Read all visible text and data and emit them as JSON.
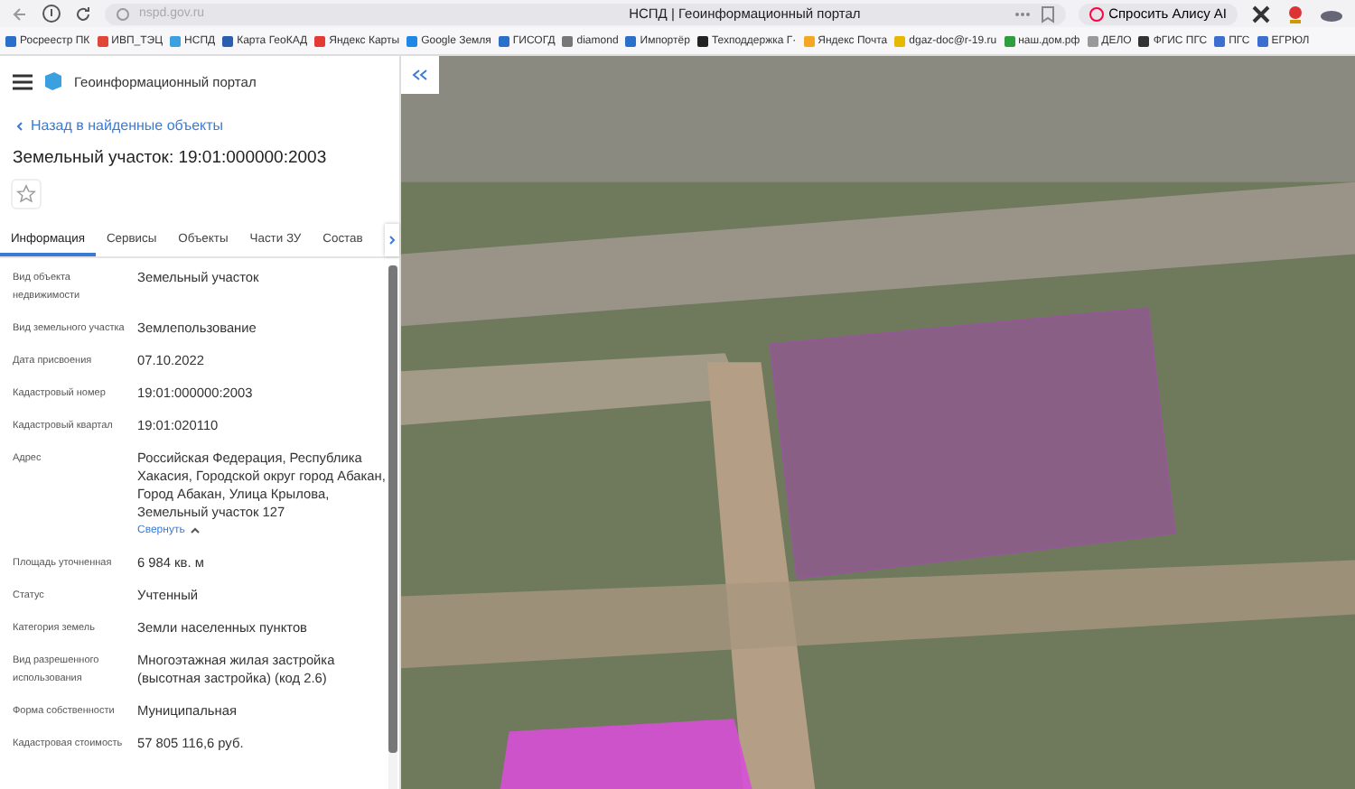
{
  "browser": {
    "url": "nspd.gov.ru",
    "title": "НСПД | Геоинформационный портал",
    "assistant_button": "Спросить Алису AI"
  },
  "bookmarks": [
    {
      "label": "Росреестр ПК",
      "color": "#2a6fc9"
    },
    {
      "label": "ИВП_ТЭЦ",
      "color": "#e0463a"
    },
    {
      "label": "НСПД",
      "color": "#3aa0e0"
    },
    {
      "label": "Карта ГеоКАД",
      "color": "#2a5fb0"
    },
    {
      "label": "Яндекс Карты",
      "color": "#e53935"
    },
    {
      "label": "Google Земля",
      "color": "#1e88e5"
    },
    {
      "label": "ГИСОГД",
      "color": "#2a6fc9"
    },
    {
      "label": "diamond",
      "color": "#777777"
    },
    {
      "label": "Импортёр",
      "color": "#2a6fc9"
    },
    {
      "label": "Техподдержка Г·",
      "color": "#222222"
    },
    {
      "label": "Яндекс Почта",
      "color": "#f5a623"
    },
    {
      "label": "dgaz-doc@r-19.ru",
      "color": "#e6b800"
    },
    {
      "label": "наш.дом.рф",
      "color": "#2e9e3e"
    },
    {
      "label": "ДЕЛО",
      "color": "#999999"
    },
    {
      "label": "ФГИС ПГС",
      "color": "#333333"
    },
    {
      "label": "ПГС",
      "color": "#3a6fd0"
    },
    {
      "label": "ЕГРЮЛ",
      "color": "#3a6fd0"
    }
  ],
  "portal": {
    "title": "Геоинформационный портал",
    "back_link": "Назад в найденные объекты",
    "heading": "Земельный участок: 19:01:000000:2003",
    "favorite": false
  },
  "tabs": [
    {
      "label": "Информация",
      "selected": true
    },
    {
      "label": "Сервисы",
      "selected": false
    },
    {
      "label": "Объекты",
      "selected": false
    },
    {
      "label": "Части ЗУ",
      "selected": false
    },
    {
      "label": "Состав",
      "selected": false
    }
  ],
  "fields": [
    {
      "label": "Вид объекта недвижимости",
      "value": "Земельный участок"
    },
    {
      "label": "Вид земельного участка",
      "value": "Землепользование"
    },
    {
      "label": "Дата присвоения",
      "value": "07.10.2022"
    },
    {
      "label": "Кадастровый номер",
      "value": "19:01:000000:2003"
    },
    {
      "label": "Кадастровый квартал",
      "value": "19:01:020110"
    },
    {
      "label": "Адрес",
      "value": "Российская Федерация, Республика Хакасия, Городской округ город Абакан, Город Абакан, Улица Крылова, Земельный участок 127",
      "toggle": "Свернуть"
    },
    {
      "label": "Площадь уточненная",
      "value": "6 984 кв. м"
    },
    {
      "label": "Статус",
      "value": "Учтенный"
    },
    {
      "label": "Категория земель",
      "value": "Земли населенных пунктов"
    },
    {
      "label": "Вид разрешенного использования",
      "value": "Многоэтажная жилая застройка (высотная застройка) (код 2.6)"
    },
    {
      "label": "Форма собственности",
      "value": "Муниципальная"
    },
    {
      "label": "Кадастровая стоимость",
      "value": "57 805 116,6 руб."
    }
  ]
}
